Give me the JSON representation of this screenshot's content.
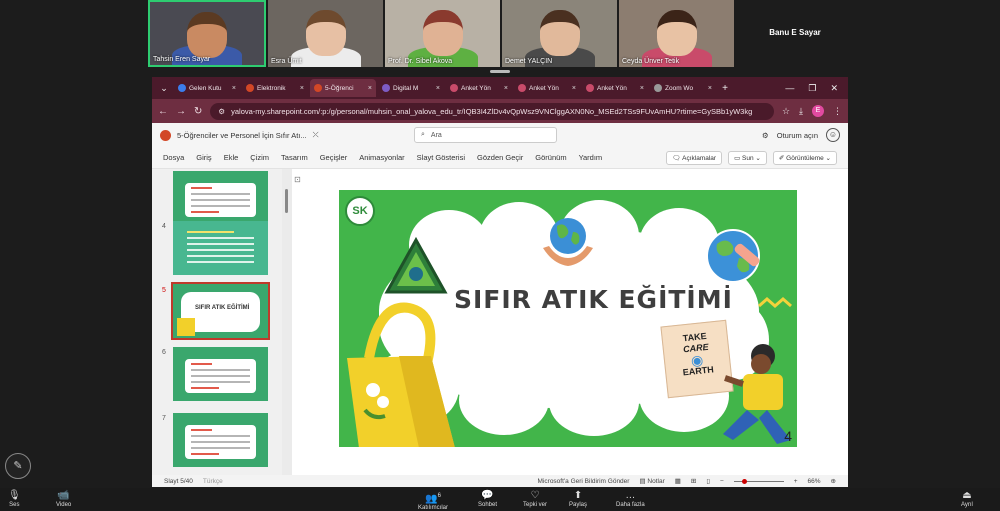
{
  "participants": [
    {
      "name": "Tahsin Eren Sayar",
      "active": true,
      "skin": "#c98a62",
      "hair": "#5b3a22",
      "shirt": "#3b5aa8",
      "bg": "#4a4a52"
    },
    {
      "name": "Esra Ümit",
      "active": false,
      "skin": "#e7c0a4",
      "hair": "#6e4a2e",
      "shirt": "#ececec",
      "bg": "#6c6660"
    },
    {
      "name": "Prof. Dr. Sibel Akova",
      "active": false,
      "skin": "#e0b294",
      "hair": "#8a3a2e",
      "shirt": "#5eb042",
      "bg": "#b8b1a5"
    },
    {
      "name": "Demet YALÇIN",
      "active": false,
      "skin": "#e1b99b",
      "hair": "#4a3020",
      "shirt": "#4a4a4a",
      "bg": "#8b857a"
    },
    {
      "name": "Ceyda Ünver Tetik",
      "active": false,
      "skin": "#e8c2a4",
      "hair": "#3b2418",
      "shirt": "#c94b6a",
      "bg": "#8c7d70"
    }
  ],
  "speaker_tile": {
    "center_name": "Banu E Sayar",
    "name": "Banu E Sayar"
  },
  "browser": {
    "tabs": [
      {
        "label": "Gelen Kutu",
        "color": "#3b7ded",
        "active": false
      },
      {
        "label": "Elektronik",
        "color": "#d24726",
        "active": false
      },
      {
        "label": "5-Öğrenci",
        "color": "#d24726",
        "active": true
      },
      {
        "label": "Digital M",
        "color": "#7d5cc4",
        "active": false
      },
      {
        "label": "Anket Yön",
        "color": "#c94b6a",
        "active": false
      },
      {
        "label": "Anket Yön",
        "color": "#c94b6a",
        "active": false
      },
      {
        "label": "Anket Yön",
        "color": "#c94b6a",
        "active": false
      },
      {
        "label": "Zoom Wo",
        "color": "#999999",
        "active": false
      }
    ],
    "url": "yalova-my.sharepoint.com/:p:/g/personal/muhsin_onal_yalova_edu_tr/IQB3I4ZlDv4vQpWsz9VNClggAXN0No_MSEd2TSs9FUvAmHU?rtime=GySBb1yW3kg",
    "profile_letter": "E"
  },
  "ppt": {
    "doc_title": "5-Öğrenciler ve Personel İçin Sıfır Atı...",
    "search_placeholder": "Ara",
    "signin": "Oturum açın",
    "menu": [
      "Dosya",
      "Giriş",
      "Ekle",
      "Çizim",
      "Tasarım",
      "Geçişler",
      "Animasyonlar",
      "Slayt Gösterisi",
      "Gözden Geçir",
      "Görünüm",
      "Yardım"
    ],
    "comments_btn": "Açıklamalar",
    "present_btn": "Sun",
    "view_btn": "Görüntüleme",
    "thumbnails": [
      {
        "num": "",
        "variant": "list"
      },
      {
        "num": "4",
        "variant": "teal"
      },
      {
        "num": "5",
        "variant": "title",
        "selected": true
      },
      {
        "num": "6",
        "variant": "list"
      },
      {
        "num": "7",
        "variant": "list"
      }
    ],
    "slide": {
      "title": "SIFIR ATIK EĞİTİMİ",
      "badge": "SK",
      "card_lines": [
        "TAKE",
        "CARE",
        "EARTH"
      ],
      "page": "4"
    },
    "status": {
      "slide": "Slayt 5/40",
      "lang": "Türkçe",
      "feedback": "Microsoft'a Geri Bildirim Gönder",
      "notes": "Notlar",
      "zoom": "66%"
    }
  },
  "zoom": {
    "items": [
      {
        "label": "Ses",
        "icon": "🎙"
      },
      {
        "label": "Video",
        "icon": "📹"
      },
      {
        "label": "Katılımcılar",
        "icon": "👥",
        "count": "6"
      },
      {
        "label": "Sohbet",
        "icon": "💬"
      },
      {
        "label": "Tepki ver",
        "icon": "♡"
      },
      {
        "label": "Paylaş",
        "icon": "⬆"
      },
      {
        "label": "Daha fazla",
        "icon": "…"
      },
      {
        "label": "Ayrıl",
        "icon": "⏏"
      }
    ]
  }
}
